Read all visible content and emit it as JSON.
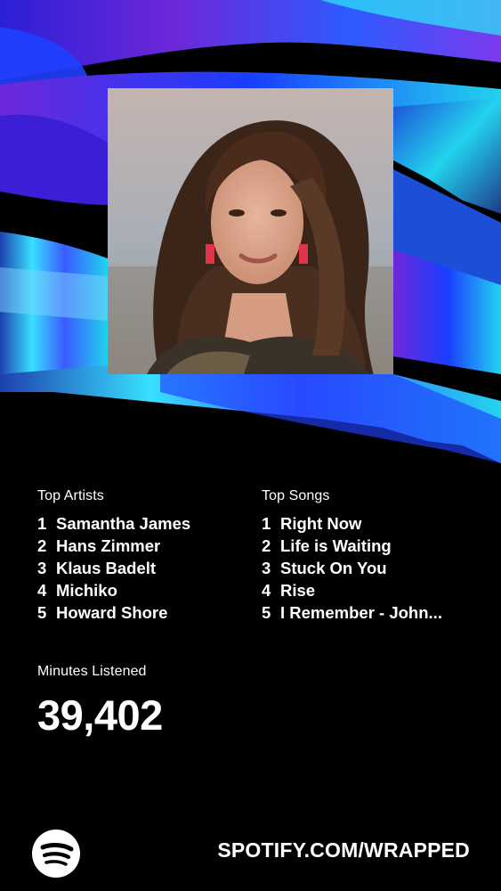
{
  "card": {
    "image_alt": "Artist portrait",
    "top_artists": {
      "label": "Top Artists",
      "items": [
        {
          "rank": "1",
          "name": "Samantha James"
        },
        {
          "rank": "2",
          "name": "Hans Zimmer"
        },
        {
          "rank": "3",
          "name": "Klaus Badelt"
        },
        {
          "rank": "4",
          "name": "Michiko"
        },
        {
          "rank": "5",
          "name": "Howard Shore"
        }
      ]
    },
    "top_songs": {
      "label": "Top Songs",
      "items": [
        {
          "rank": "1",
          "name": "Right Now"
        },
        {
          "rank": "2",
          "name": "Life is Waiting"
        },
        {
          "rank": "3",
          "name": "Stuck On You"
        },
        {
          "rank": "4",
          "name": "Rise"
        },
        {
          "rank": "5",
          "name": "I Remember - John..."
        }
      ]
    },
    "minutes": {
      "label": "Minutes Listened",
      "value": "39,402"
    },
    "footer": {
      "url": "SPOTIFY.COM/WRAPPED",
      "logo_icon": "spotify-logo-icon"
    }
  },
  "colors": {
    "background": "#000000",
    "accent_blue": "#1a3dff",
    "accent_cyan": "#22d3ee",
    "accent_purple": "#7c3aed",
    "text": "#ffffff"
  }
}
